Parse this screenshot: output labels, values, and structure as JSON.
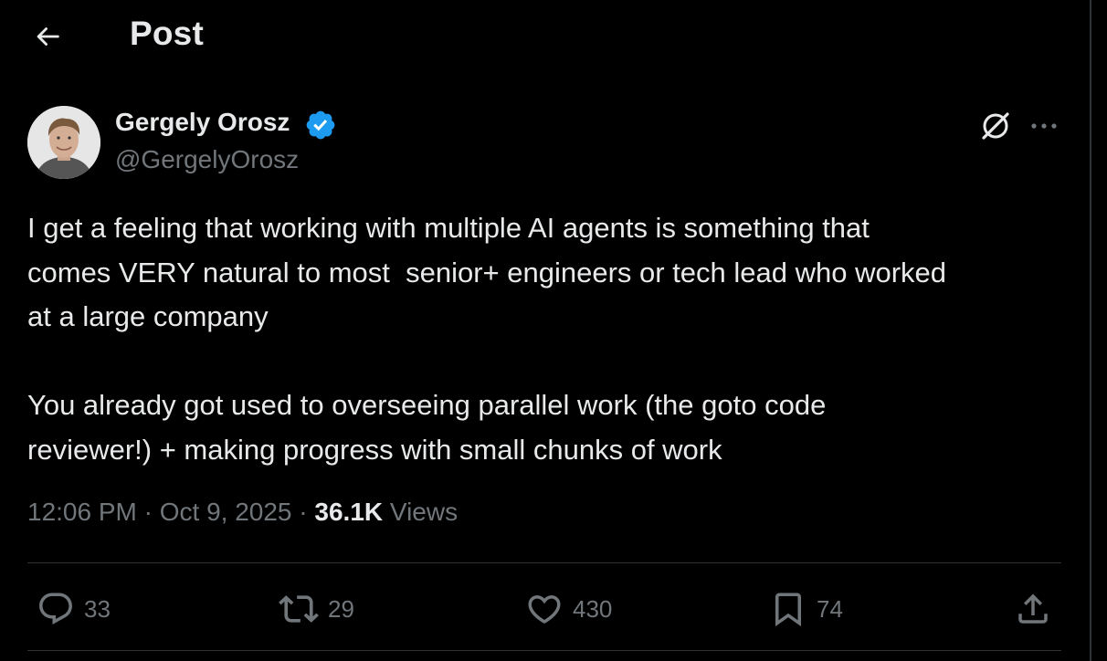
{
  "header": {
    "title": "Post",
    "back_icon": "arrow-left-icon"
  },
  "author": {
    "name": "Gergely Orosz",
    "handle": "@GergelyOrosz",
    "verified_icon": "verified-badge-icon",
    "verified_color": "#1d9bf0"
  },
  "tweet": {
    "paragraphs": [
      [
        "I get a feeling that working with multiple AI agents is something that",
        "comes VERY natural to most  senior+ engineers or tech lead who worked",
        "at a large company"
      ],
      [
        "You already got used to overseeing parallel work (the goto code",
        "reviewer!) + making progress with small chunks of work"
      ]
    ]
  },
  "meta": {
    "time": "12:06 PM",
    "separator": " · ",
    "date": "Oct 9, 2025",
    "views_count": "36.1K",
    "views_label": " Views"
  },
  "actions": {
    "replies": "33",
    "reposts": "29",
    "likes": "430",
    "bookmarks": "74"
  },
  "colors": {
    "background": "#000000",
    "text": "#e7e9ea",
    "muted": "#71767b",
    "border": "#2f3336",
    "accent": "#1d9bf0"
  }
}
